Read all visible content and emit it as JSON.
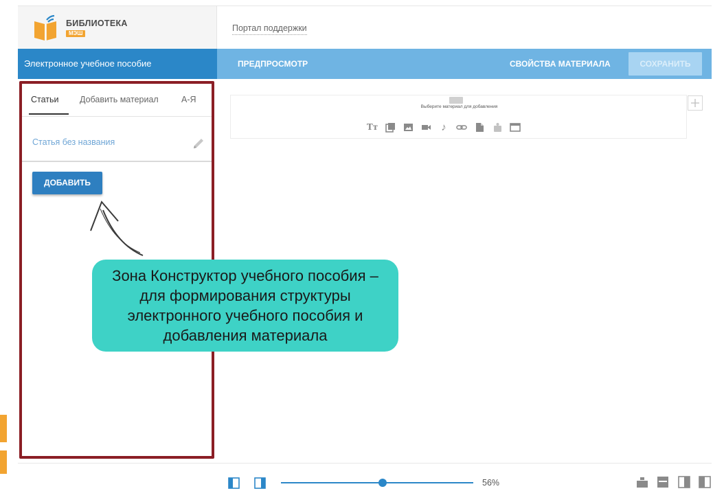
{
  "header": {
    "logo_title": "БИБЛИОТЕКА",
    "logo_badge": "МЭШ",
    "support_link": "Портал поддержки"
  },
  "toolbar": {
    "left_title": "Электронное учебное пособие",
    "preview": "ПРЕДПРОСМОТР",
    "properties": "СВОЙСТВА МАТЕРИАЛА",
    "save": "СОХРАНИТЬ"
  },
  "panel": {
    "tabs": [
      {
        "label": "Статьи",
        "active": true
      },
      {
        "label": "Добавить материал",
        "active": false
      },
      {
        "label": "А-Я",
        "active": false
      }
    ],
    "article_title": "Статья без названия",
    "add_button": "ДОБАВИТЬ"
  },
  "material_box": {
    "hint": "Выберите материал для добавления",
    "tools": [
      {
        "icon": "text-icon",
        "glyph": "Tт"
      },
      {
        "icon": "gallery-icon",
        "glyph": ""
      },
      {
        "icon": "image-icon",
        "glyph": ""
      },
      {
        "icon": "video-icon",
        "glyph": ""
      },
      {
        "icon": "music-icon",
        "glyph": "♪"
      },
      {
        "icon": "link-icon",
        "glyph": ""
      },
      {
        "icon": "document-icon",
        "glyph": ""
      },
      {
        "icon": "puzzle-icon",
        "glyph": ""
      },
      {
        "icon": "window-icon",
        "glyph": ""
      }
    ]
  },
  "annotation": {
    "text": "Зона Конструктор учебного пособия – для формирования структуры электронного учебного пособия и добавления материала"
  },
  "bottom": {
    "zoom": "56%",
    "zoom_level": 0.56
  },
  "colors": {
    "primary_blue": "#2b87c8",
    "light_blue": "#6fb4e3",
    "callout": "#3ed2c6",
    "highlight_border": "#8b1e25",
    "accent_orange": "#f2a431"
  }
}
